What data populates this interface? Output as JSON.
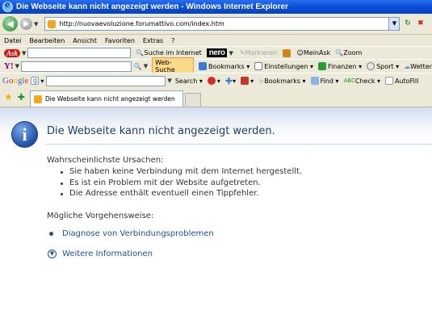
{
  "window": {
    "title": "Die Webseite kann nicht angezeigt werden - Windows Internet Explorer"
  },
  "address": {
    "url": "http://nuovaevoluzione.forumattivo.com/index.htm"
  },
  "menu": [
    "Datei",
    "Bearbeiten",
    "Ansicht",
    "Favoriten",
    "Extras",
    "?"
  ],
  "ask_toolbar": {
    "logo": "Ask",
    "search_label": "Suche im Internet",
    "nero_logo": "nero",
    "markieren": "Markieren",
    "meinask": "MeinAsk",
    "zoom": "Zoom"
  },
  "yahoo_toolbar": {
    "logo": "Y!",
    "websuche": "Web-Suche",
    "bookmarks": "Bookmarks",
    "einstellungen": "Einstellungen",
    "finanzen": "Finanzen",
    "sport": "Sport",
    "wetter": "Wetter"
  },
  "google_toolbar": {
    "logo": "Google",
    "search": "Search",
    "bookmarks": "Bookmarks",
    "find": "Find",
    "check": "Check",
    "autofill": "AutoFill"
  },
  "tab": {
    "title": "Die Webseite kann nicht angezeigt werden"
  },
  "page": {
    "heading": "Die Webseite kann nicht angezeigt werden.",
    "causes_heading": "Wahrscheinlichste Ursachen:",
    "causes": [
      "Sie haben keine Verbindung mit dem Internet hergestellt.",
      "Es ist ein Problem mit der Website aufgetreten.",
      "Die Adresse enthält eventuell einen Tippfehler."
    ],
    "actions_heading": "Mögliche Vorgehensweise:",
    "diagnose_link": "Diagnose von Verbindungsproblemen",
    "more_info": "Weitere Informationen"
  }
}
